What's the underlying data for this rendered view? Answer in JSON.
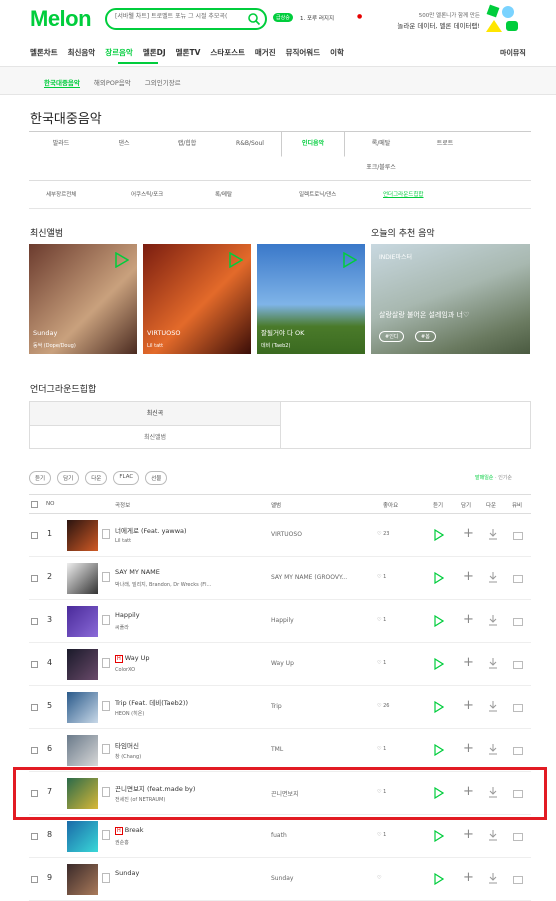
{
  "header": {
    "logo": "Melon",
    "search_value": "[서바웰 차트] 트로벨트 포뉴 그 시절 추모곡(",
    "badge": "급상승",
    "hot_keyword": "1. 포루 러지지",
    "promo_line1": "500만 멜론니가 함께 만든",
    "promo_line2": "놀라운 데이터, 멜론 데이터랩!"
  },
  "gnb": {
    "items": [
      "멜론차트",
      "최신음악",
      "장르음악",
      "멜론DJ",
      "멜론TV",
      "스타포스트",
      "매거진",
      "뮤직어워드",
      "이학"
    ],
    "right": "마이뮤직"
  },
  "subnav": {
    "items": [
      "한국대중음악",
      "해외POP음악",
      "그외인기장르"
    ]
  },
  "page_title": "한국대중음악",
  "genre_tabs": [
    "발라드",
    "댄스",
    "랩/힙합",
    "R&B/Soul",
    "인디음악",
    "록/메탈",
    "트로트",
    "포크/블루스"
  ],
  "sub_genres": [
    "세부장르전체",
    "어쿠스틱/포크",
    "록/메탈",
    "일렉트로닉/댄스",
    "언더그라운드힙합"
  ],
  "latest_albums": {
    "title": "최신앨범",
    "items": [
      {
        "title": "Sunday",
        "artist": "동싹 (Dope/Doug)",
        "colors": [
          "#6b3b2e",
          "#c9a17d"
        ]
      },
      {
        "title": "VIRTUOSO",
        "artist": "Lil tatt",
        "colors": [
          "#7a1d10",
          "#e36a2a"
        ]
      },
      {
        "title": "잘될거야 다 OK",
        "artist": "데비 (Taeb2)",
        "colors": [
          "#3a78c9",
          "#7fb4e8"
        ]
      }
    ]
  },
  "recommend": {
    "title": "오늘의 추천 음악",
    "badge": "INDIE마스터",
    "text": "살랑살랑 불어온 설레임과 너♡",
    "tags": [
      "#인디",
      "#봄"
    ]
  },
  "underground": {
    "title": "언더그라운드힙합",
    "tab_on": "최신곡",
    "tab_off": "최신앨범"
  },
  "actions": [
    "듣기",
    "담기",
    "다운",
    "FLAC",
    "선물"
  ],
  "sort": {
    "on": "발매일순",
    "off": "인기순"
  },
  "table_headers": {
    "no": "NO",
    "song": "곡정보",
    "album": "앨범",
    "like": "좋아요",
    "play": "듣기",
    "add": "담기",
    "download": "다운",
    "mv": "뮤비"
  },
  "songs": [
    {
      "no": "1",
      "title": "너에게로 (Feat. yawwa)",
      "artist": "Lil tatt",
      "album": "VIRTUOSO",
      "likes": "23",
      "hot": false,
      "thumb": [
        "#2a1410",
        "#d05a25"
      ]
    },
    {
      "no": "2",
      "title": "SAY MY NAME",
      "artist": "박나래, 빌리지, Brandon, Dr Wrecks (Fl...",
      "album": "SAY MY NAME (GROOVY...",
      "likes": "1",
      "hot": false,
      "thumb": [
        "#eee",
        "#333"
      ]
    },
    {
      "no": "3",
      "title": "Happily",
      "artist": "씨플라",
      "album": "Happily",
      "likes": "1",
      "hot": false,
      "thumb": [
        "#4a2a9a",
        "#8a6ad8"
      ]
    },
    {
      "no": "4",
      "title": "Way Up",
      "artist": "ColorXO",
      "album": "Way Up",
      "likes": "1",
      "hot": true,
      "thumb": [
        "#1a1a2a",
        "#6a4a6a"
      ]
    },
    {
      "no": "5",
      "title": "Trip (Feat. 데비(Taeb2))",
      "artist": "HEON (히온)",
      "album": "Trip",
      "likes": "26",
      "hot": false,
      "thumb": [
        "#2a5a8a",
        "#c8d8e8"
      ]
    },
    {
      "no": "6",
      "title": "타임머신",
      "artist": "창 (Chang)",
      "album": "TML",
      "likes": "1",
      "hot": false,
      "thumb": [
        "#6a7a8a",
        "#d8d8d8"
      ]
    },
    {
      "no": "7",
      "title": "끈니면보지 (feat.made by)",
      "artist": "전세진 (of NETRAUM)",
      "album": "끈니면보지",
      "likes": "1",
      "hot": false,
      "thumb": [
        "#2a6a4a",
        "#d8b838"
      ]
    },
    {
      "no": "8",
      "title": "Break",
      "artist": "권순홍",
      "album": "fuath",
      "likes": "1",
      "hot": true,
      "thumb": [
        "#1a6aa8",
        "#3ad8d8"
      ]
    },
    {
      "no": "9",
      "title": "Sunday",
      "artist": "",
      "album": "Sunday",
      "likes": "",
      "hot": false,
      "thumb": [
        "#3a2a2a",
        "#aa7a5a"
      ]
    }
  ],
  "colors": {
    "brand": "#00cd3c",
    "highlight": "#e21b23"
  }
}
